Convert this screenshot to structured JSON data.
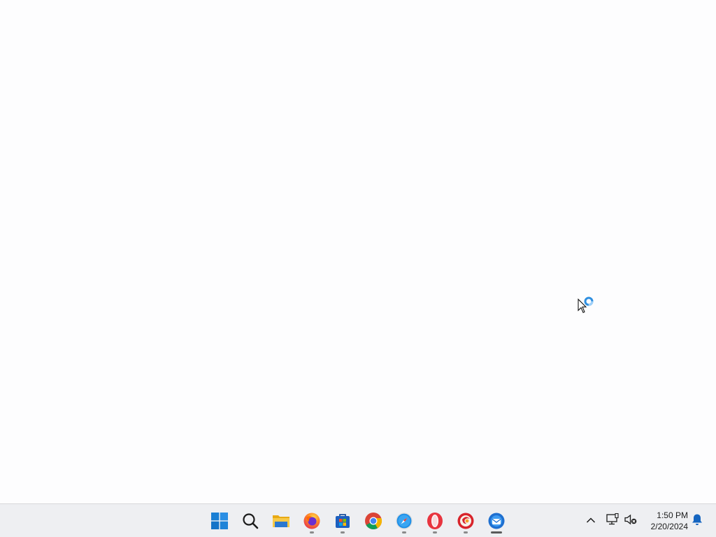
{
  "taskbar": {
    "apps": [
      {
        "name": "Start",
        "icon": "windows-start-icon"
      },
      {
        "name": "Search",
        "icon": "search-icon"
      },
      {
        "name": "File Explorer",
        "icon": "file-explorer-icon"
      },
      {
        "name": "Firefox",
        "icon": "firefox-icon"
      },
      {
        "name": "Microsoft Store",
        "icon": "microsoft-store-icon"
      },
      {
        "name": "Google Chrome",
        "icon": "chrome-icon"
      },
      {
        "name": "Safari",
        "icon": "safari-icon"
      },
      {
        "name": "Opera",
        "icon": "opera-icon"
      },
      {
        "name": "Pale Moon",
        "icon": "browser-icon"
      },
      {
        "name": "Thunderbird",
        "icon": "thunderbird-icon"
      }
    ],
    "tray": {
      "icons": [
        "chevron-up-icon",
        "network-icon",
        "volume-muted-icon",
        "notification-bell-icon"
      ],
      "time": "1:50 PM",
      "date": "2/20/2024"
    }
  },
  "cursor": {
    "state": "busy",
    "icon": "busy-cursor-icon"
  },
  "colors": {
    "taskbar_bg": "#eeeff2",
    "desktop_bg": "#fdfdfe",
    "start_blue": "#1a7fd4",
    "accent_blue": "#1e6fd0"
  }
}
